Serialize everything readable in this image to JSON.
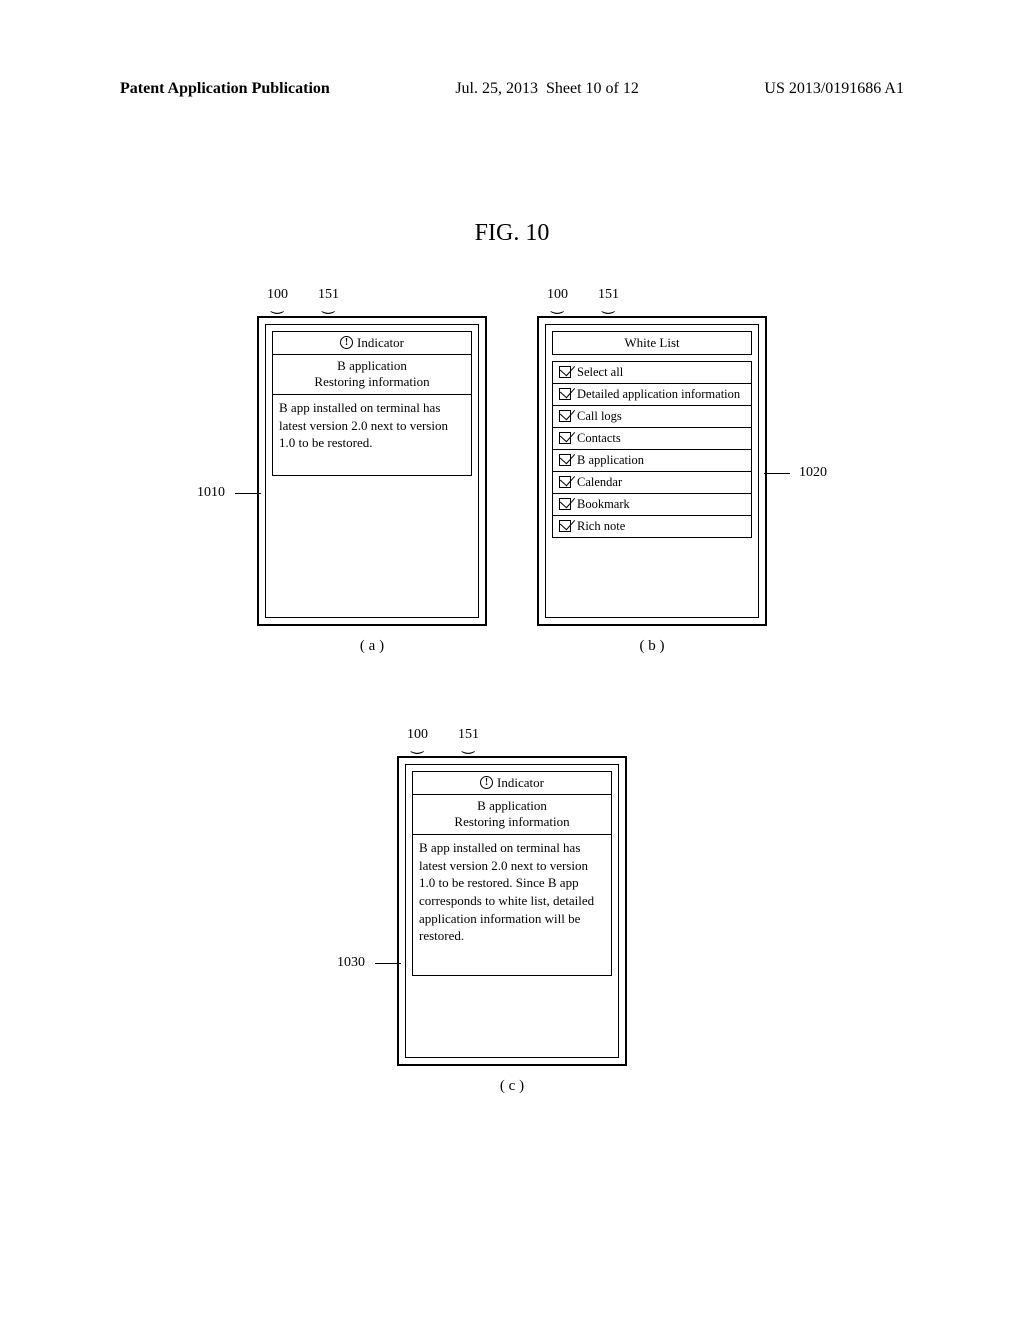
{
  "header": {
    "publication": "Patent Application Publication",
    "date": "Jul. 25, 2013",
    "sheet": "Sheet 10 of 12",
    "pubnum": "US 2013/0191686 A1"
  },
  "fig_title": "FIG. 10",
  "refs": {
    "device_ref": "100",
    "screen_ref": "151",
    "callout_a": "1010",
    "callout_b": "1020",
    "callout_c": "1030"
  },
  "panel_a": {
    "indicator_label": "Indicator",
    "app_title": "B application",
    "subtitle": "Restoring information",
    "body": "B app installed on terminal has latest version 2.0 next to version 1.0 to be restored.",
    "sublabel": "( a )"
  },
  "panel_b": {
    "header": "White List",
    "items": [
      "Select all",
      "Detailed application information",
      "Call logs",
      "Contacts",
      "B application",
      "Calendar",
      "Bookmark",
      "Rich note"
    ],
    "sublabel": "( b )"
  },
  "panel_c": {
    "indicator_label": "Indicator",
    "app_title": "B application",
    "subtitle": "Restoring information",
    "body": "B app installed on terminal has latest version 2.0 next to version 1.0 to be restored. Since B app corresponds to white list, detailed application information will be restored.",
    "sublabel": "( c )"
  }
}
